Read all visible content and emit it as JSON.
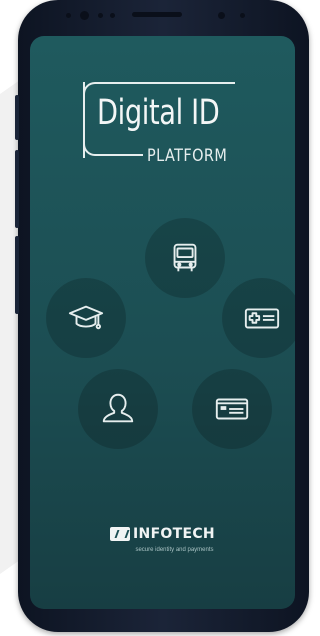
{
  "logo": {
    "title": "Digital ID",
    "subtitle": "PLATFORM"
  },
  "services": [
    {
      "icon": "bus-icon"
    },
    {
      "icon": "graduation-cap-icon"
    },
    {
      "icon": "health-card-icon"
    },
    {
      "icon": "user-icon"
    },
    {
      "icon": "id-card-icon"
    }
  ],
  "brand": {
    "name": "INFOTECH",
    "tagline": "secure identity and payments"
  },
  "colors": {
    "screen_top": "#1f5a5e",
    "screen_bottom": "#173e43",
    "icon_stroke": "#e6eeee",
    "phone_body": "#1b2438"
  }
}
